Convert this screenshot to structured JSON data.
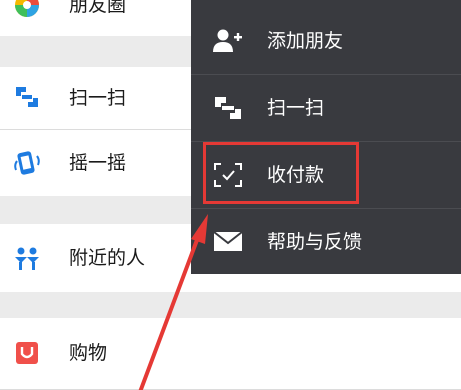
{
  "left_list": {
    "items": [
      {
        "label": "朋友圈",
        "icon": "moments-icon"
      },
      {
        "label": "扫一扫",
        "icon": "scan-icon"
      },
      {
        "label": "摇一摇",
        "icon": "shake-icon"
      },
      {
        "label": "附近的人",
        "icon": "people-nearby-icon"
      },
      {
        "label": "购物",
        "icon": "shopping-icon"
      }
    ]
  },
  "popup_menu": {
    "items": [
      {
        "label": "添加朋友",
        "icon": "add-friend-icon"
      },
      {
        "label": "扫一扫",
        "icon": "scan-icon"
      },
      {
        "label": "收付款",
        "icon": "pay-icon"
      },
      {
        "label": "帮助与反馈",
        "icon": "mail-icon"
      }
    ]
  },
  "colors": {
    "menu_bg": "#393a3f",
    "highlight": "#e53935",
    "accent_blue": "#1e7be0",
    "shopping_red": "#f0504a"
  }
}
